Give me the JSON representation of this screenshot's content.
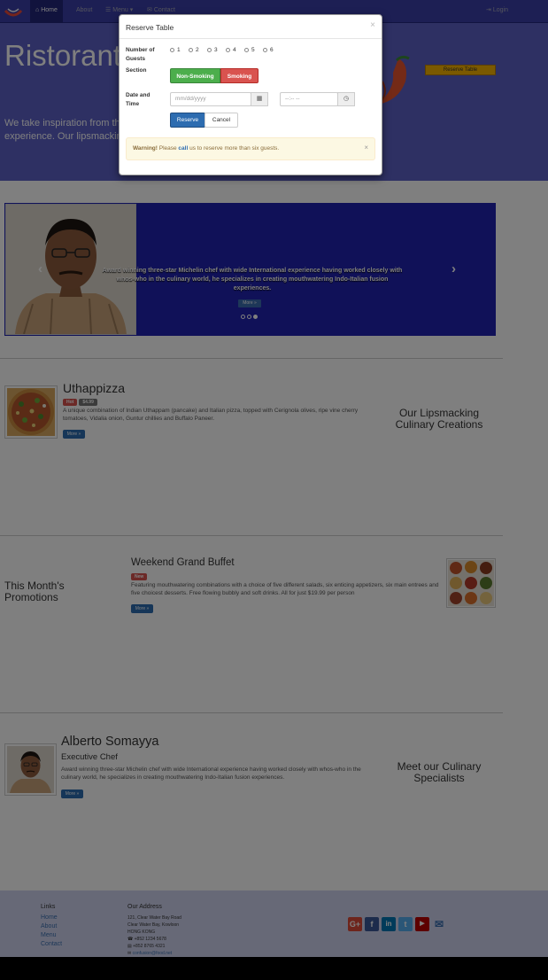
{
  "navbar": {
    "items": [
      {
        "label": "Home",
        "icon": "home-icon"
      },
      {
        "label": "About"
      },
      {
        "label": "Menu",
        "icon": "list-icon"
      },
      {
        "label": "Contact",
        "icon": "envelope-icon"
      }
    ],
    "login_label": "Login"
  },
  "jumbotron": {
    "title": "Ristorante",
    "text": "We take inspiration from the experience. Our lipsmacking",
    "reserve_button": "Reserve Table"
  },
  "carousel": {
    "caption": "Award winning three-star Michelin chef with wide International experience having worked closely with whos-who in the culinary world, he specializes in creating mouthwatering Indo-Italian fusion experiences.",
    "button": "More »",
    "active_slide": 3,
    "slide_count": 3
  },
  "dish": {
    "title": "Uthappizza",
    "badge_label": "Hot",
    "price": "$4.99",
    "description": "A unique combination of Indian Uthappam (pancake) and Italian pizza, topped with Cerignola olives, ripe vine cherry tomatoes, Vidalia onion, Guntur chillies and Buffalo Paneer.",
    "more_button": "More »",
    "side_heading": "Our Lipsmacking Culinary Creations"
  },
  "promotion": {
    "side_heading": "This Month's Promotions",
    "title": "Weekend Grand Buffet",
    "badge_label": "New",
    "description": "Featuring mouthwatering combinations with a choice of five different salads, six enticing appetizers, six main entrees and five choicest desserts. Free flowing bubbly and soft drinks. All for just $19.99 per person",
    "more_button": "More »"
  },
  "leader": {
    "name": "Alberto Somayya",
    "designation": "Executive Chef",
    "description": "Award winning three-star Michelin chef with wide International experience having worked closely with whos-who in the culinary world, he specializes in creating mouthwatering Indo-Italian fusion experiences.",
    "more_button": "More »",
    "side_heading": "Meet our Culinary Specialists"
  },
  "footer": {
    "links_heading": "Links",
    "links": [
      "Home",
      "About",
      "Menu",
      "Contact"
    ],
    "address_heading": "Our Address",
    "address_lines": [
      "121, Clear Water Bay Road",
      "Clear Water Bay, Kowloon",
      "HONG KONG"
    ],
    "phone": "+852 1234 5678",
    "fax": "+852 8765 4321",
    "email": "confusion@food.net",
    "social": [
      {
        "name": "google-plus",
        "label": "G+",
        "color": "#dd4b39"
      },
      {
        "name": "facebook",
        "label": "f",
        "color": "#3b5998"
      },
      {
        "name": "linkedin",
        "label": "in",
        "color": "#0077b5"
      },
      {
        "name": "twitter",
        "label": "t",
        "color": "#55acee"
      },
      {
        "name": "youtube",
        "label": "▶",
        "color": "#bb0000"
      },
      {
        "name": "mail",
        "label": "✉",
        "color": "#3a6fb0"
      }
    ]
  },
  "modal": {
    "title": "Reserve Table",
    "close": "×",
    "guests_label": "Number of Guests",
    "guest_options": [
      "1",
      "2",
      "3",
      "4",
      "5",
      "6"
    ],
    "section_label": "Section",
    "section_options": [
      "Non-Smoking",
      "Smoking"
    ],
    "datetime_label": "Date and Time",
    "date_placeholder": "mm/dd/yyyy",
    "time_placeholder": "--:-- --",
    "reserve_button": "Reserve",
    "cancel_button": "Cancel",
    "warning_strong": "Warning!",
    "warning_pre": "Please",
    "warning_link": "call",
    "warning_post": "us to reserve more than six guests.",
    "warning_close": "×"
  },
  "colors": {
    "navbar": "#3a3fa8",
    "jumbotron": "#5c60c6",
    "carousel": "#2023b0",
    "primary": "#2d6cb0",
    "success": "#4cae4c",
    "danger": "#d9534f",
    "warning": "#f7b200"
  }
}
